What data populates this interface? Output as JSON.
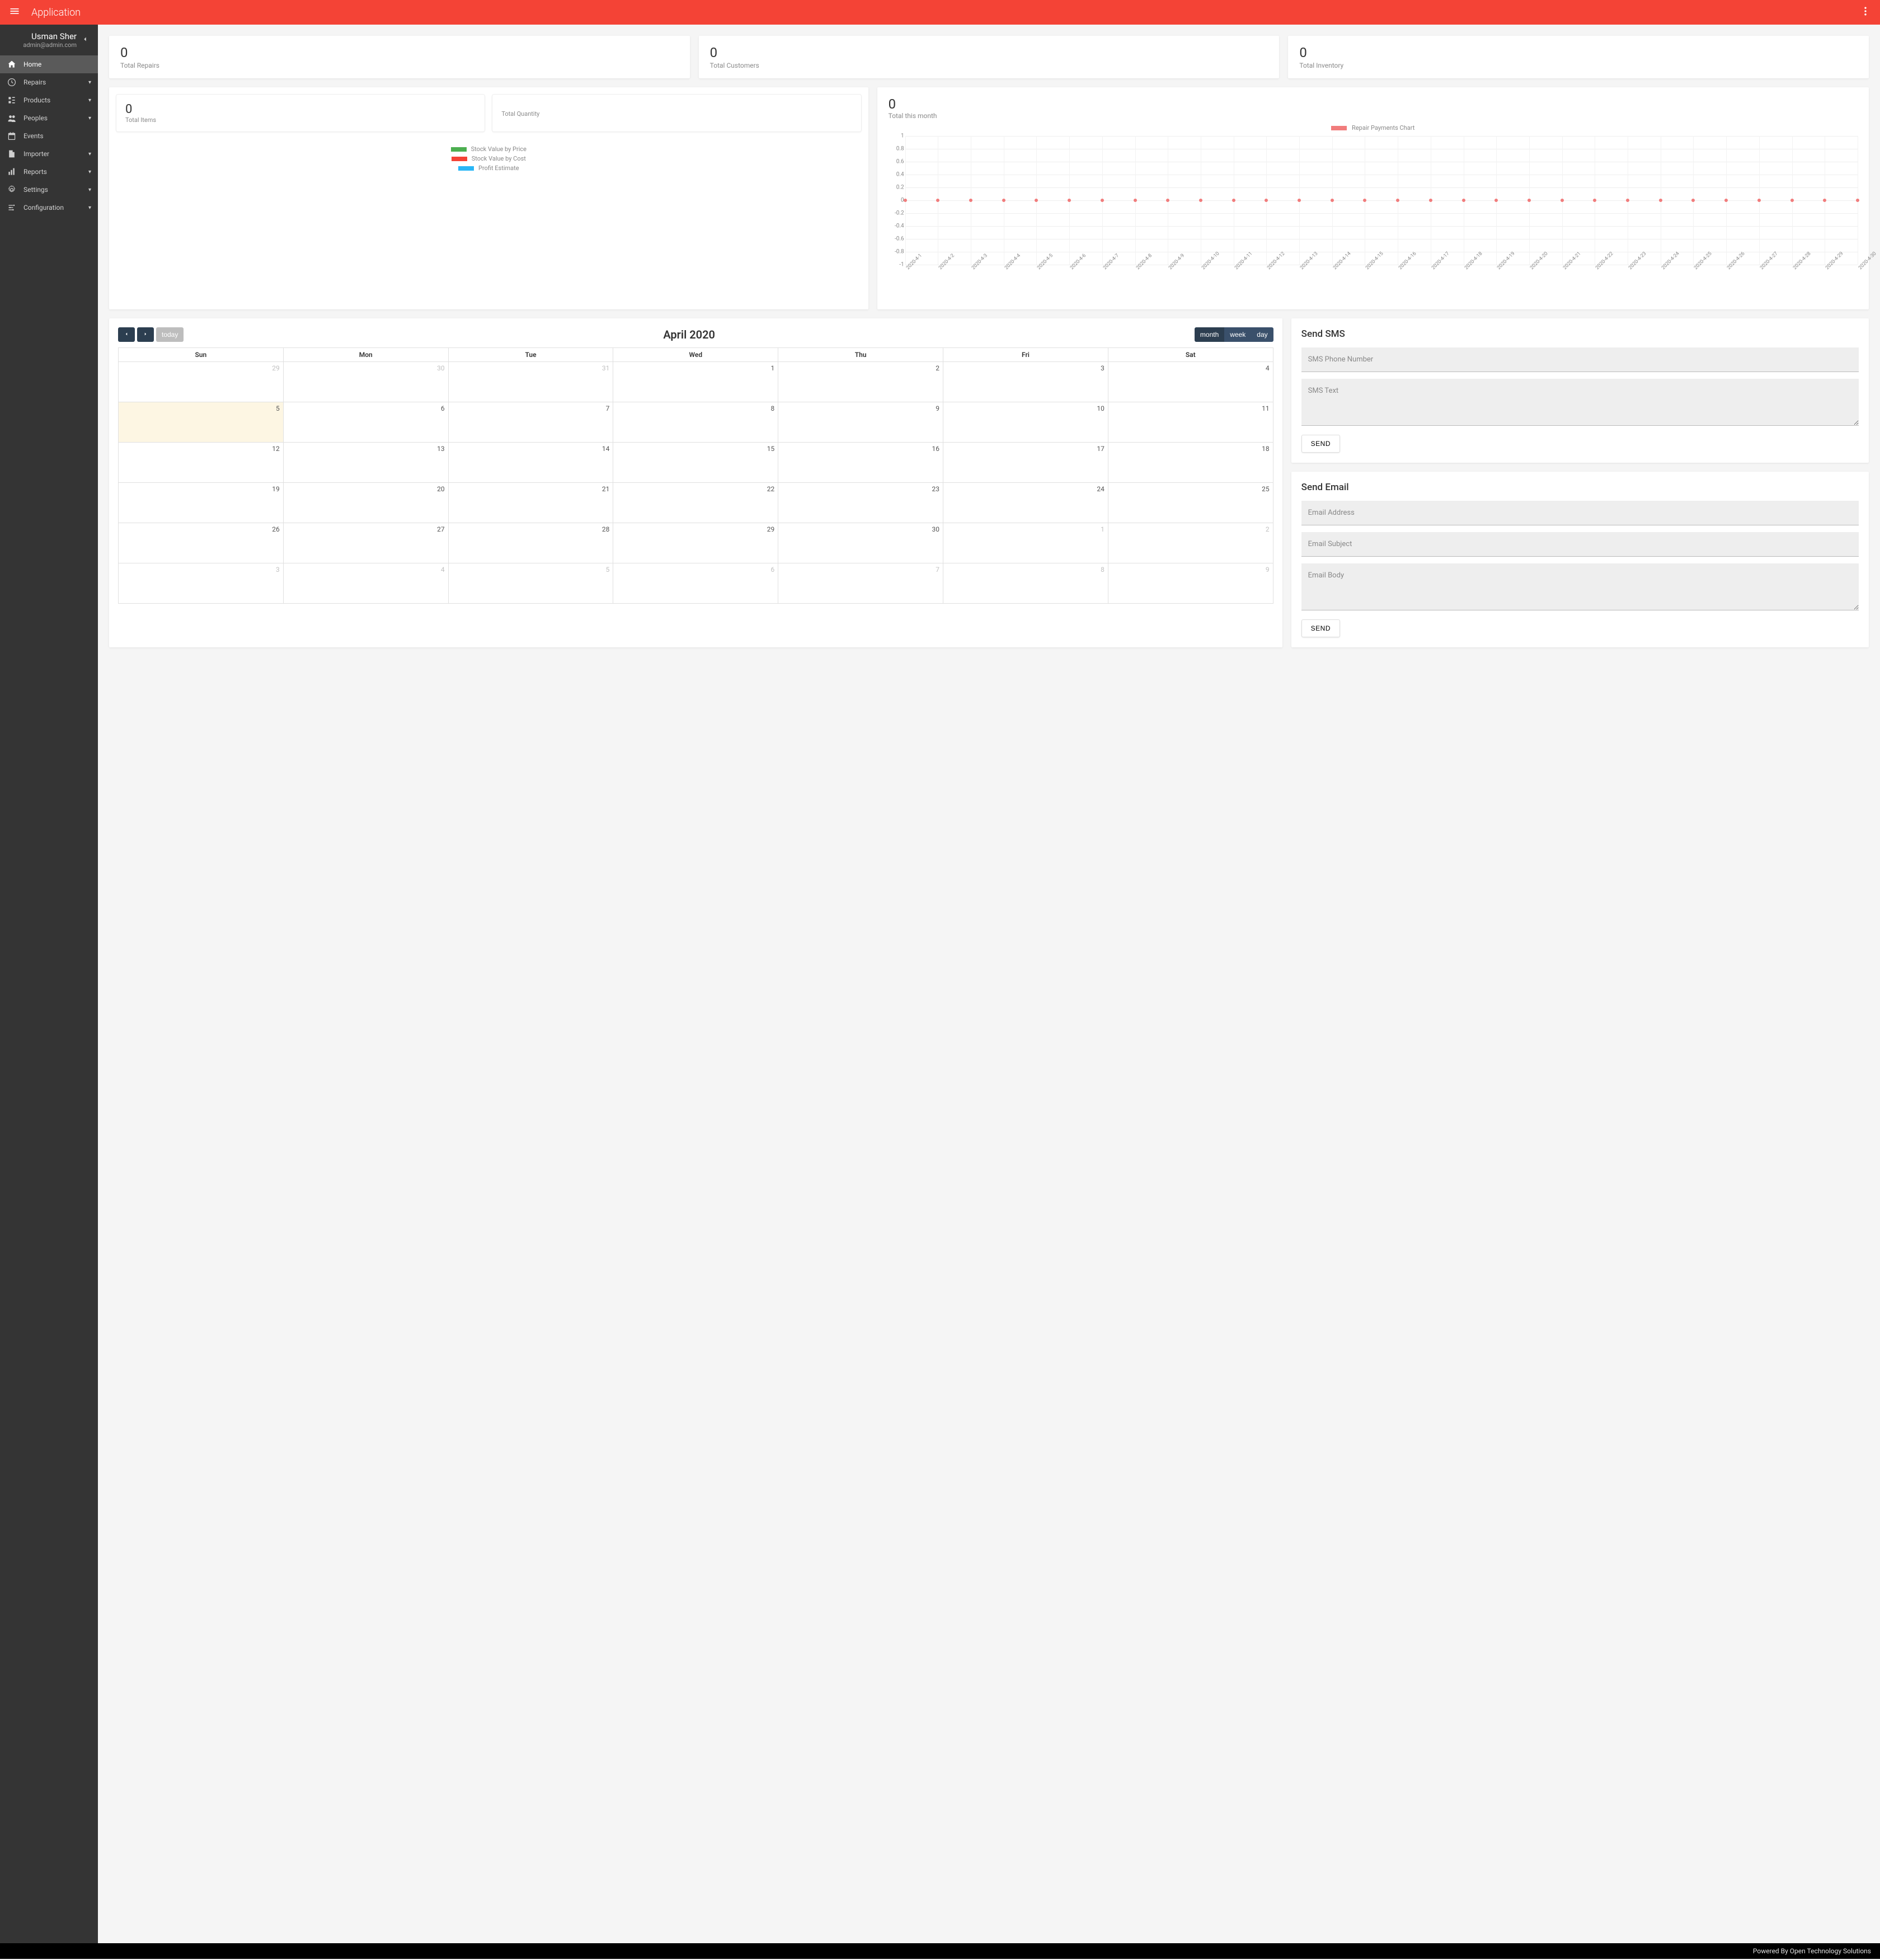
{
  "header": {
    "title": "Application"
  },
  "user": {
    "name": "Usman Sher",
    "email": "admin@admin.com"
  },
  "sidebar": {
    "items": [
      {
        "icon": "home",
        "label": "Home",
        "active": true,
        "expandable": false
      },
      {
        "icon": "repairs",
        "label": "Repairs",
        "active": false,
        "expandable": true
      },
      {
        "icon": "products",
        "label": "Products",
        "active": false,
        "expandable": true
      },
      {
        "icon": "peoples",
        "label": "Peoples",
        "active": false,
        "expandable": true
      },
      {
        "icon": "events",
        "label": "Events",
        "active": false,
        "expandable": false
      },
      {
        "icon": "importer",
        "label": "Importer",
        "active": false,
        "expandable": true
      },
      {
        "icon": "reports",
        "label": "Reports",
        "active": false,
        "expandable": true
      },
      {
        "icon": "settings",
        "label": "Settings",
        "active": false,
        "expandable": true
      },
      {
        "icon": "config",
        "label": "Configuration",
        "active": false,
        "expandable": true
      }
    ]
  },
  "kpis": [
    {
      "value": "0",
      "label": "Total Repairs"
    },
    {
      "value": "0",
      "label": "Total Customers"
    },
    {
      "value": "0",
      "label": "Total Inventory"
    }
  ],
  "stock": {
    "items": {
      "value": "0",
      "label": "Total Items"
    },
    "quantity": {
      "label": "Total Quantity"
    },
    "legend": [
      {
        "color": "#4caf50",
        "label": "Stock Value by Price"
      },
      {
        "color": "#f44336",
        "label": "Stock Value by Cost"
      },
      {
        "color": "#29b6f6",
        "label": "Profit Estimate"
      }
    ]
  },
  "chart": {
    "monthly": {
      "value": "0",
      "label": "Total this month"
    },
    "legend": {
      "color": "#f17c7c",
      "label": "Repair Payments Chart"
    }
  },
  "chart_data": {
    "type": "line",
    "title": "Repair Payments Chart",
    "x": [
      "2020-4-1",
      "2020-4-2",
      "2020-4-3",
      "2020-4-4",
      "2020-4-5",
      "2020-4-6",
      "2020-4-7",
      "2020-4-8",
      "2020-4-9",
      "2020-4-10",
      "2020-4-11",
      "2020-4-12",
      "2020-4-13",
      "2020-4-14",
      "2020-4-15",
      "2020-4-16",
      "2020-4-17",
      "2020-4-18",
      "2020-4-19",
      "2020-4-20",
      "2020-4-21",
      "2020-4-22",
      "2020-4-23",
      "2020-4-24",
      "2020-4-25",
      "2020-4-26",
      "2020-4-27",
      "2020-4-28",
      "2020-4-29",
      "2020-4-30"
    ],
    "series": [
      {
        "name": "Repair Payments Chart",
        "values": [
          0,
          0,
          0,
          0,
          0,
          0,
          0,
          0,
          0,
          0,
          0,
          0,
          0,
          0,
          0,
          0,
          0,
          0,
          0,
          0,
          0,
          0,
          0,
          0,
          0,
          0,
          0,
          0,
          0,
          0
        ]
      }
    ],
    "ylim": [
      -1.0,
      1.0
    ],
    "yticks": [
      1.0,
      0.8,
      0.6,
      0.4,
      0.2,
      0,
      -0.2,
      -0.4,
      -0.6,
      -0.8,
      -1.0
    ],
    "xlabel": "",
    "ylabel": ""
  },
  "calendar": {
    "title": "April 2020",
    "today_label": "today",
    "views": {
      "month": "month",
      "week": "week",
      "day": "day"
    },
    "day_headers": [
      "Sun",
      "Mon",
      "Tue",
      "Wed",
      "Thu",
      "Fri",
      "Sat"
    ],
    "cells": [
      {
        "n": "29",
        "other": true
      },
      {
        "n": "30",
        "other": true
      },
      {
        "n": "31",
        "other": true
      },
      {
        "n": "1"
      },
      {
        "n": "2"
      },
      {
        "n": "3"
      },
      {
        "n": "4"
      },
      {
        "n": "5",
        "today": true
      },
      {
        "n": "6"
      },
      {
        "n": "7"
      },
      {
        "n": "8"
      },
      {
        "n": "9"
      },
      {
        "n": "10"
      },
      {
        "n": "11"
      },
      {
        "n": "12"
      },
      {
        "n": "13"
      },
      {
        "n": "14"
      },
      {
        "n": "15"
      },
      {
        "n": "16"
      },
      {
        "n": "17"
      },
      {
        "n": "18"
      },
      {
        "n": "19"
      },
      {
        "n": "20"
      },
      {
        "n": "21"
      },
      {
        "n": "22"
      },
      {
        "n": "23"
      },
      {
        "n": "24"
      },
      {
        "n": "25"
      },
      {
        "n": "26"
      },
      {
        "n": "27"
      },
      {
        "n": "28"
      },
      {
        "n": "29"
      },
      {
        "n": "30"
      },
      {
        "n": "1",
        "other": true
      },
      {
        "n": "2",
        "other": true
      },
      {
        "n": "3",
        "other": true
      },
      {
        "n": "4",
        "other": true
      },
      {
        "n": "5",
        "other": true
      },
      {
        "n": "6",
        "other": true
      },
      {
        "n": "7",
        "other": true
      },
      {
        "n": "8",
        "other": true
      },
      {
        "n": "9",
        "other": true
      }
    ]
  },
  "sms": {
    "title": "Send SMS",
    "phone_placeholder": "SMS Phone Number",
    "text_placeholder": "SMS Text",
    "send": "SEND"
  },
  "email": {
    "title": "Send Email",
    "address_placeholder": "Email Address",
    "subject_placeholder": "Email Subject",
    "body_placeholder": "Email Body",
    "send": "SEND"
  },
  "footer": {
    "text": "Powered By Open Technology Solutions"
  }
}
